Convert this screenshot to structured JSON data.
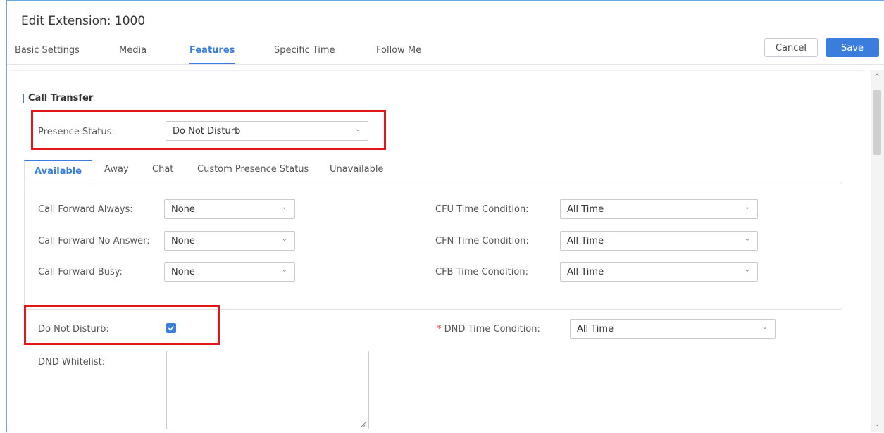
{
  "header": {
    "title": "Edit Extension: 1000",
    "tabs": [
      "Basic Settings",
      "Media",
      "Features",
      "Specific Time",
      "Follow Me"
    ],
    "active_tab": "Features",
    "cancel_label": "Cancel",
    "save_label": "Save"
  },
  "colors": {
    "accent": "#3b7ddd",
    "highlight_box": "#e0161b",
    "required": "#e33333"
  },
  "section": {
    "title": "Call Transfer"
  },
  "presence": {
    "label": "Presence Status:",
    "value": "Do Not Disturb"
  },
  "presence_tabs": {
    "items": [
      "Available",
      "Away",
      "Chat",
      "Custom Presence Status",
      "Unavailable"
    ],
    "active": "Available"
  },
  "forwarding": {
    "rows": [
      {
        "label": "Call Forward Always:",
        "value": "None",
        "time_label": "CFU Time Condition:",
        "time_value": "All Time"
      },
      {
        "label": "Call Forward No Answer:",
        "value": "None",
        "time_label": "CFN Time Condition:",
        "time_value": "All Time"
      },
      {
        "label": "Call Forward Busy:",
        "value": "None",
        "time_label": "CFB Time Condition:",
        "time_value": "All Time"
      }
    ]
  },
  "dnd": {
    "label": "Do Not Disturb:",
    "checked": true,
    "required_mark": "*",
    "time_label": "DND Time Condition:",
    "time_value": "All Time",
    "whitelist_label": "DND Whitelist:",
    "whitelist_value": ""
  }
}
